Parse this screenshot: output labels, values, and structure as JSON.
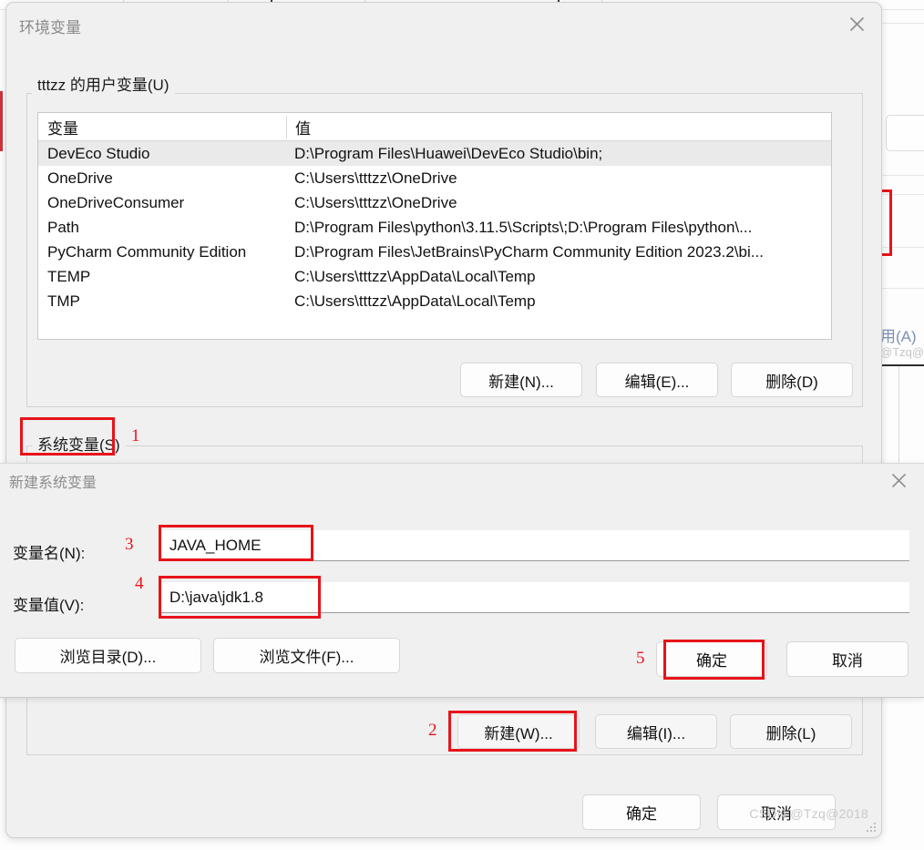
{
  "background": {
    "partial_link_text": "用(A)",
    "partial_watermark": "@Tzq@"
  },
  "env_dialog": {
    "title": "环境变量",
    "close_icon": "close-icon",
    "user_vars_group": {
      "label": "tttzz 的用户变量(U)",
      "columns": [
        "变量",
        "值"
      ],
      "rows": [
        {
          "name": "DevEco Studio",
          "value": "D:\\Program Files\\Huawei\\DevEco Studio\\bin;",
          "selected": true
        },
        {
          "name": "OneDrive",
          "value": "C:\\Users\\tttzz\\OneDrive",
          "selected": false
        },
        {
          "name": "OneDriveConsumer",
          "value": "C:\\Users\\tttzz\\OneDrive",
          "selected": false
        },
        {
          "name": "Path",
          "value": "D:\\Program Files\\python\\3.11.5\\Scripts\\;D:\\Program Files\\python\\...",
          "selected": false
        },
        {
          "name": "PyCharm Community Edition",
          "value": "D:\\Program Files\\JetBrains\\PyCharm Community Edition 2023.2\\bi...",
          "selected": false
        },
        {
          "name": "TEMP",
          "value": "C:\\Users\\tttzz\\AppData\\Local\\Temp",
          "selected": false
        },
        {
          "name": "TMP",
          "value": "C:\\Users\\tttzz\\AppData\\Local\\Temp",
          "selected": false
        }
      ],
      "buttons": {
        "new": "新建(N)...",
        "edit": "编辑(E)...",
        "delete": "删除(D)"
      }
    },
    "system_vars_group": {
      "label": "系统变量(S)",
      "buttons": {
        "new": "新建(W)...",
        "edit": "编辑(I)...",
        "delete": "删除(L)"
      }
    },
    "footer_buttons": {
      "ok": "确定",
      "cancel": "取消"
    }
  },
  "new_var_dialog": {
    "title": "新建系统变量",
    "close_icon": "close-icon",
    "fields": {
      "name_label": "变量名(N):",
      "name_value": "JAVA_HOME",
      "value_label": "变量值(V):",
      "value_value": "D:\\java\\jdk1.8"
    },
    "buttons": {
      "browse_dir": "浏览目录(D)...",
      "browse_file": "浏览文件(F)...",
      "ok": "确定",
      "cancel": "取消"
    }
  },
  "annotations": {
    "colors": {
      "marker_red": "#e8131a"
    },
    "steps": [
      {
        "num": "1",
        "target": "系统变量(S)"
      },
      {
        "num": "2",
        "target": "新建(W)..."
      },
      {
        "num": "3",
        "target": "变量名(N) 输入框"
      },
      {
        "num": "4",
        "target": "变量值(V) 输入框"
      },
      {
        "num": "5",
        "target": "确定"
      }
    ]
  },
  "watermark": {
    "text": "CSDN @Tzq@2018"
  }
}
